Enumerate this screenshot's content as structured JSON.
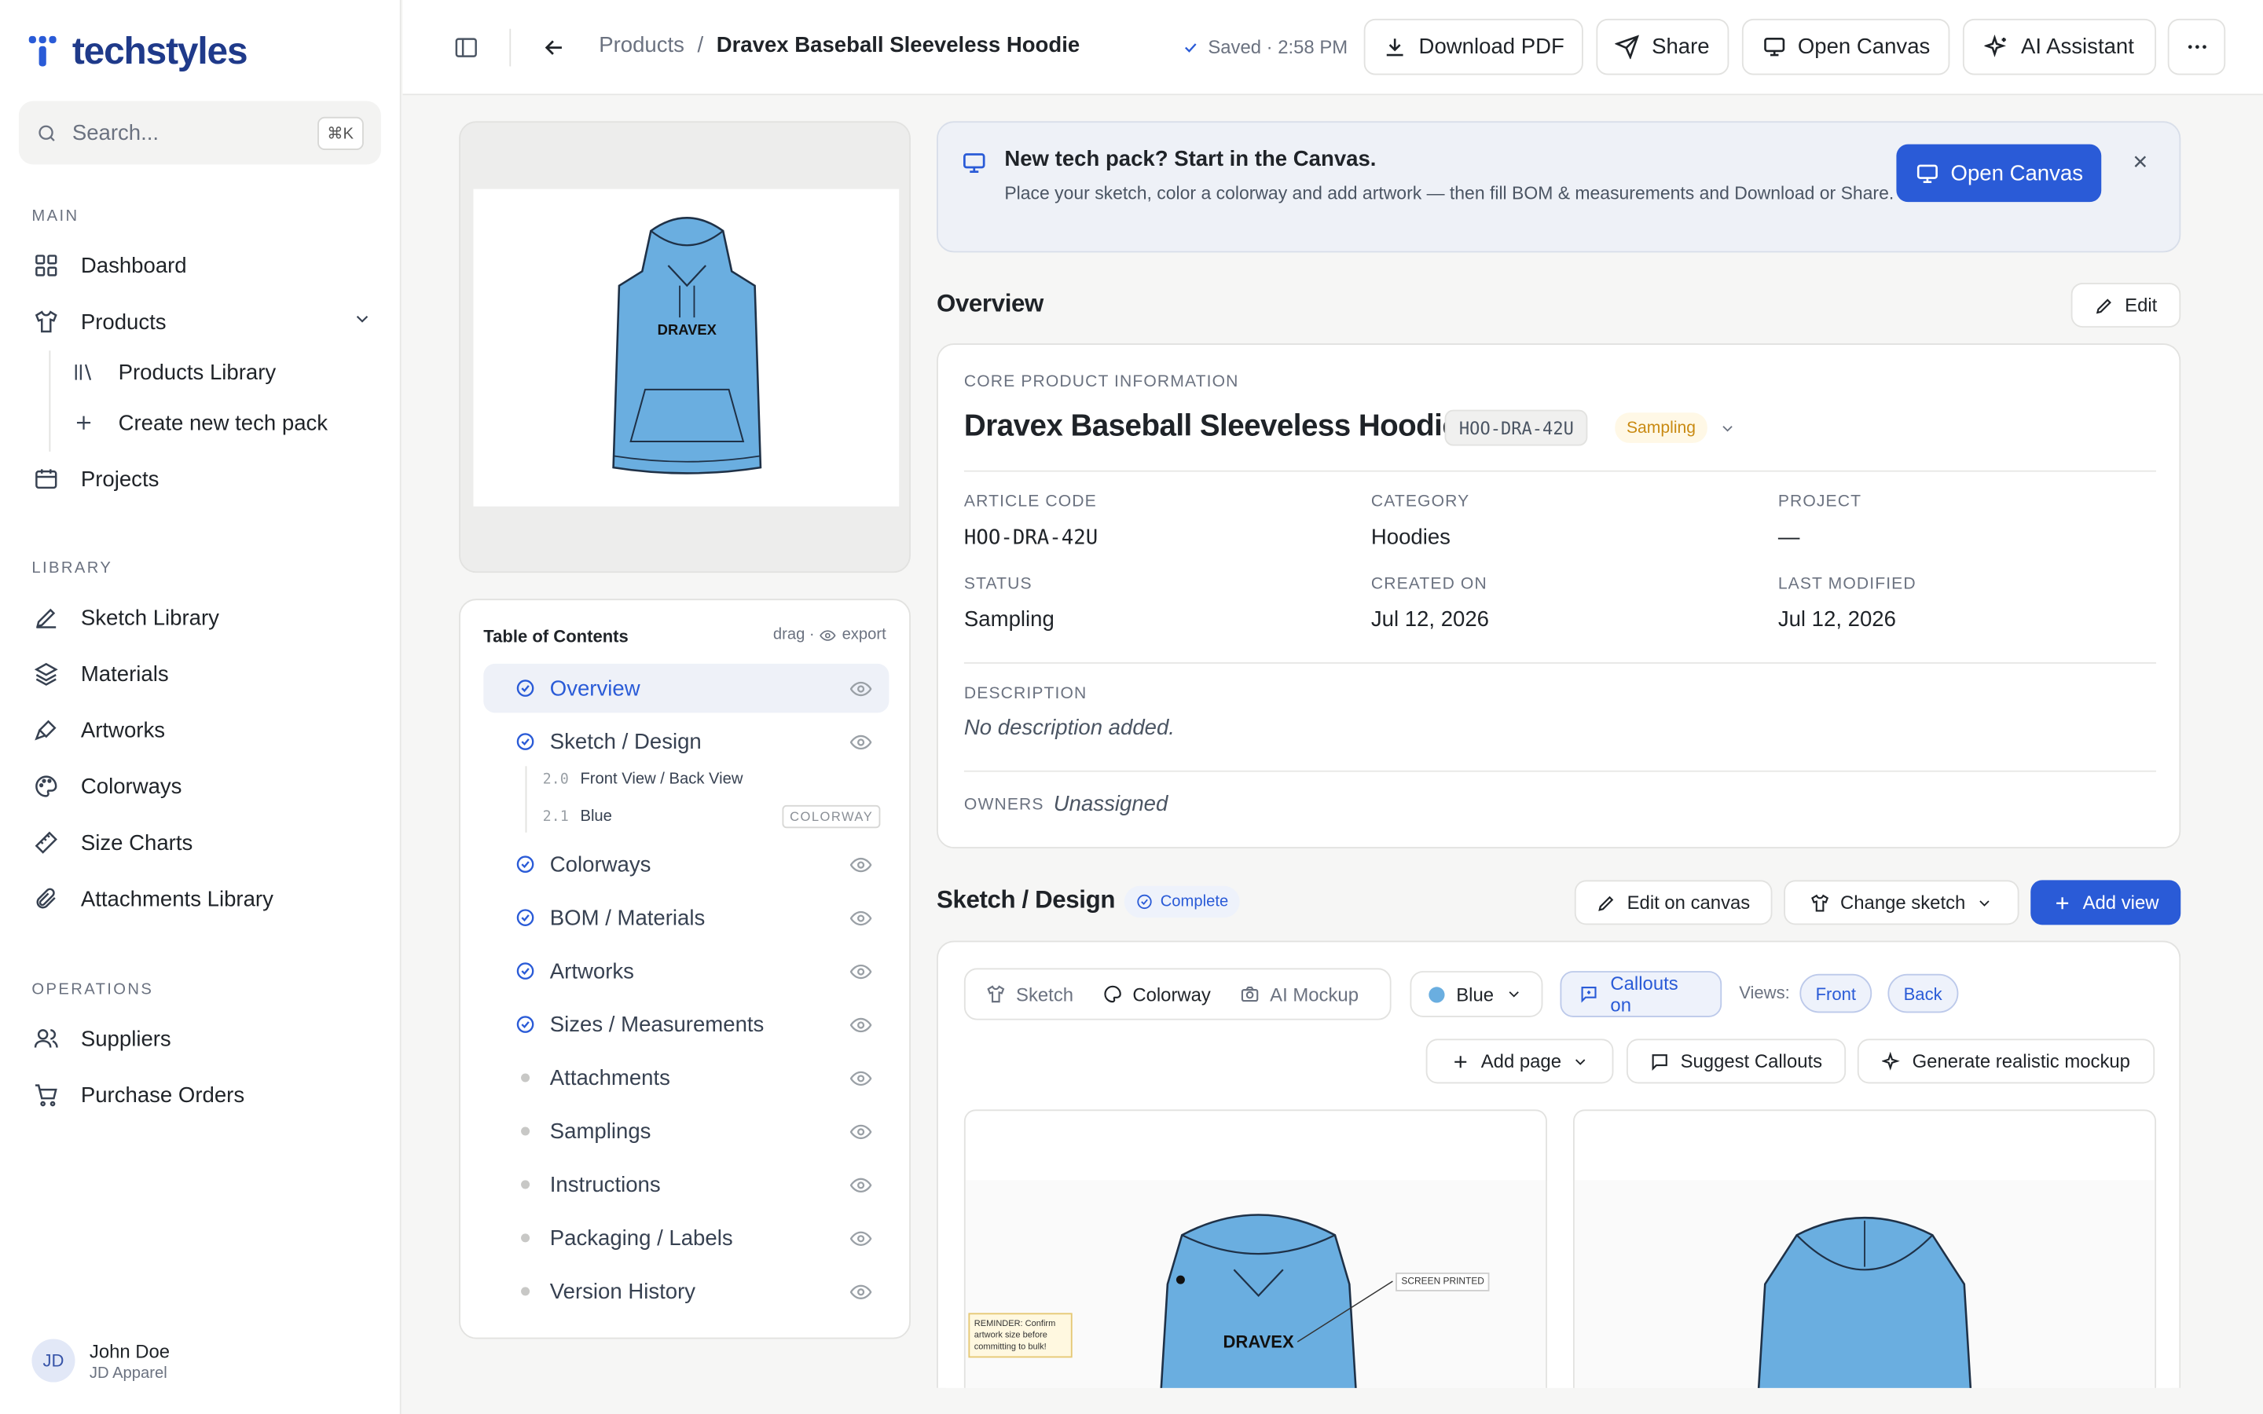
{
  "app": {
    "logo_text": "techstyles",
    "brand_color": "#2a5bd7"
  },
  "sidebar": {
    "search_placeholder": "Search...",
    "search_shortcut": "⌘K",
    "sections": {
      "main": "MAIN",
      "library": "LIBRARY",
      "operations": "OPERATIONS"
    },
    "main_items": [
      {
        "label": "Dashboard",
        "icon": "grid-icon"
      },
      {
        "label": "Products",
        "icon": "shirt-icon"
      },
      {
        "label": "Products Library",
        "icon": "library-icon"
      },
      {
        "label": "Create new tech pack",
        "icon": "plus-icon"
      },
      {
        "label": "Projects",
        "icon": "calendar-icon"
      }
    ],
    "library_items": [
      {
        "label": "Sketch Library",
        "icon": "pen-icon"
      },
      {
        "label": "Materials",
        "icon": "layers-icon"
      },
      {
        "label": "Artworks",
        "icon": "brush-icon"
      },
      {
        "label": "Colorways",
        "icon": "palette-icon"
      },
      {
        "label": "Size Charts",
        "icon": "ruler-icon"
      },
      {
        "label": "Attachments Library",
        "icon": "paperclip-icon"
      }
    ],
    "operations_items": [
      {
        "label": "Suppliers",
        "icon": "users-icon"
      },
      {
        "label": "Purchase Orders",
        "icon": "cart-icon"
      }
    ],
    "user": {
      "initials": "JD",
      "name": "John Doe",
      "org": "JD Apparel"
    }
  },
  "topbar": {
    "breadcrumb_parent": "Products",
    "breadcrumb_sep": "/",
    "breadcrumb_current": "Dravex Baseball Sleeveless Hoodie",
    "saved_status": "Saved · 2:58 PM",
    "download_pdf": "Download PDF",
    "share": "Share",
    "open_canvas": "Open Canvas",
    "ai_assistant": "AI Assistant"
  },
  "toc": {
    "title": "Table of Contents",
    "hint": "drag · ",
    "hint_export": "export",
    "items": [
      {
        "label": "Overview",
        "done": true
      },
      {
        "label": "Sketch / Design",
        "done": true
      },
      {
        "label": "Colorways",
        "done": true
      },
      {
        "label": "BOM / Materials",
        "done": true
      },
      {
        "label": "Artworks",
        "done": true
      },
      {
        "label": "Sizes / Measurements",
        "done": true
      },
      {
        "label": "Attachments",
        "done": false
      },
      {
        "label": "Samplings",
        "done": false
      },
      {
        "label": "Instructions",
        "done": false
      },
      {
        "label": "Packaging / Labels",
        "done": false
      },
      {
        "label": "Version History",
        "done": false
      }
    ],
    "sub_items": [
      {
        "num": "2.0",
        "label": "Front View / Back View",
        "badge": ""
      },
      {
        "num": "2.1",
        "label": "Blue",
        "badge": "COLORWAY"
      }
    ]
  },
  "banner": {
    "title": "New tech pack? Start in the Canvas.",
    "description": "Place your sketch, color a colorway and add artwork — then fill BOM & measurements and Download or Share.",
    "button": "Open Canvas"
  },
  "overview": {
    "heading": "Overview",
    "edit": "Edit",
    "section_label": "CORE PRODUCT INFORMATION",
    "product_name": "Dravex Baseball Sleeveless Hoodie",
    "sku": "HOO-DRA-42U",
    "status_chip": "Sampling",
    "fields": {
      "article_code_label": "ARTICLE CODE",
      "article_code": "HOO-DRA-42U",
      "category_label": "CATEGORY",
      "category": "Hoodies",
      "project_label": "PROJECT",
      "project": "—",
      "status_label": "STATUS",
      "status": "Sampling",
      "created_label": "CREATED ON",
      "created": "Jul 12, 2026",
      "modified_label": "LAST MODIFIED",
      "modified": "Jul 12, 2026"
    },
    "description_label": "DESCRIPTION",
    "description": "No description added.",
    "owners_label": "OWNERS",
    "owners": "Unassigned"
  },
  "sketch": {
    "heading": "Sketch / Design",
    "status_badge": "Complete",
    "edit_on_canvas": "Edit on canvas",
    "change_sketch": "Change sketch",
    "add_view": "Add view",
    "tabs": [
      "Sketch",
      "Colorway",
      "AI Mockup"
    ],
    "active_tab": "Colorway",
    "colorway": "Blue",
    "colorway_color": "#6aaee0",
    "callouts": "Callouts on",
    "views_label": "Views:",
    "views": [
      "Front",
      "Back"
    ],
    "add_page": "Add page",
    "suggest_callouts": "Suggest Callouts",
    "generate_mockup": "Generate realistic mockup",
    "note_text": "REMINDER: Confirm artwork size before committing to bulk!",
    "callout_tag": "SCREEN PRINTED",
    "brand_print": "DRAVEX"
  }
}
